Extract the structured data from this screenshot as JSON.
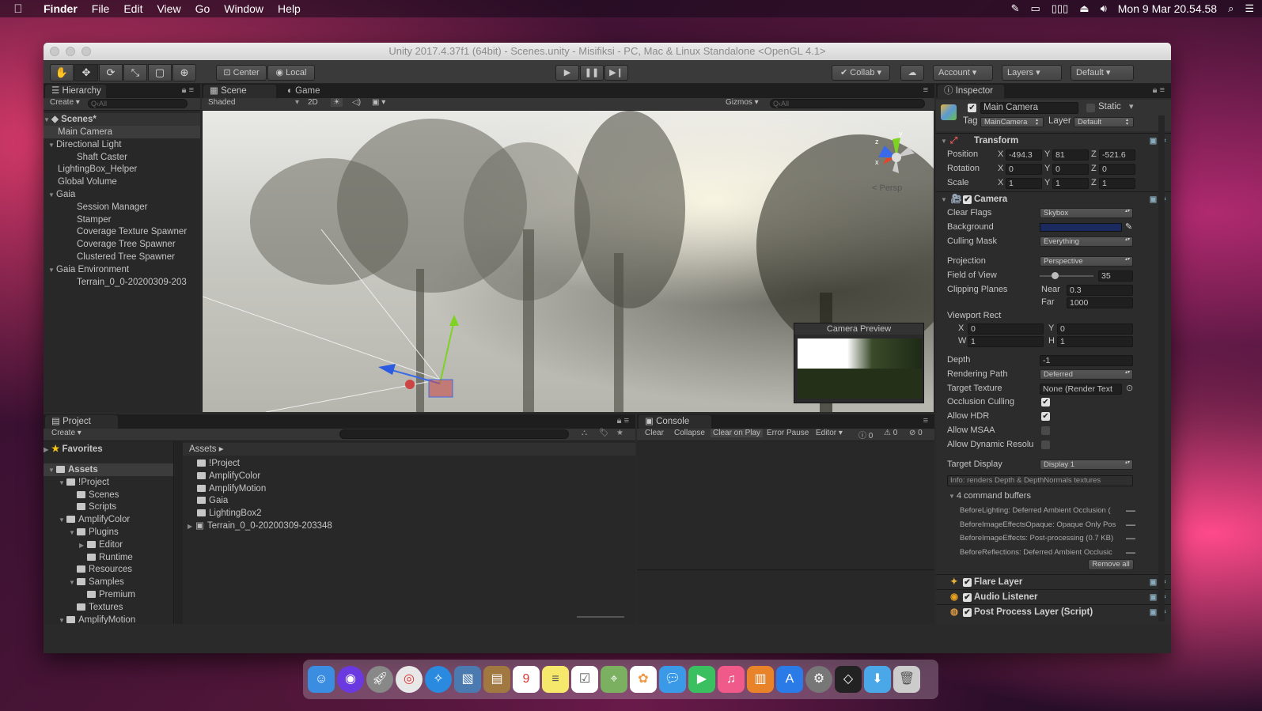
{
  "menubar": {
    "items": [
      "Finder",
      "File",
      "Edit",
      "View",
      "Go",
      "Window",
      "Help"
    ],
    "clock": "Mon 9 Mar  20.54.58"
  },
  "window": {
    "title": "Unity 2017.4.37f1 (64bit) - Scenes.unity - Misifiksi - PC, Mac & Linux Standalone <OpenGL 4.1>"
  },
  "toolbar": {
    "pivot": "Center",
    "space": "Local",
    "collab": "Collab",
    "account": "Account",
    "layers": "Layers",
    "layout": "Default"
  },
  "hierarchy": {
    "tab": "Hierarchy",
    "create": "Create",
    "search_placeholder": "Q‹All",
    "scene": "Scenes*",
    "items": [
      {
        "label": "Main Camera",
        "indent": 0,
        "selected": true
      },
      {
        "label": "Directional Light",
        "indent": 0,
        "expand": true
      },
      {
        "label": "Shaft Caster",
        "indent": 1
      },
      {
        "label": "LightingBox_Helper",
        "indent": 0
      },
      {
        "label": "Global Volume",
        "indent": 0
      },
      {
        "label": "Gaia",
        "indent": 0,
        "expand": true
      },
      {
        "label": "Session Manager",
        "indent": 1
      },
      {
        "label": "Stamper",
        "indent": 1
      },
      {
        "label": "Coverage Texture Spawner",
        "indent": 1
      },
      {
        "label": "Coverage Tree Spawner",
        "indent": 1
      },
      {
        "label": "Clustered Tree Spawner",
        "indent": 1
      },
      {
        "label": "Gaia Environment",
        "indent": 0,
        "expand": true
      },
      {
        "label": "Terrain_0_0-20200309-203",
        "indent": 1
      }
    ]
  },
  "sceneview": {
    "tab_scene": "Scene",
    "tab_game": "Game",
    "shading": "Shaded",
    "mode2d": "2D",
    "gizmos": "Gizmos",
    "search": "Q‹All",
    "persp": "< Persp",
    "camera_preview": "Camera Preview"
  },
  "project": {
    "tab": "Project",
    "create": "Create",
    "favorites": "Favorites",
    "breadcrumb": "Assets ▸",
    "tree": [
      {
        "label": "Assets",
        "indent": 0,
        "bold": true,
        "selected": true
      },
      {
        "label": "!Project",
        "indent": 1
      },
      {
        "label": "Scenes",
        "indent": 2
      },
      {
        "label": "Scripts",
        "indent": 2
      },
      {
        "label": "AmplifyColor",
        "indent": 1
      },
      {
        "label": "Plugins",
        "indent": 2
      },
      {
        "label": "Editor",
        "indent": 3
      },
      {
        "label": "Runtime",
        "indent": 3
      },
      {
        "label": "Resources",
        "indent": 2
      },
      {
        "label": "Samples",
        "indent": 2
      },
      {
        "label": "Premium",
        "indent": 3
      },
      {
        "label": "Textures",
        "indent": 2
      },
      {
        "label": "AmplifyMotion",
        "indent": 1
      }
    ],
    "assets": [
      "!Project",
      "AmplifyColor",
      "AmplifyMotion",
      "Gaia",
      "LightingBox2",
      "Terrain_0_0-20200309-203348"
    ]
  },
  "console": {
    "tab": "Console",
    "buttons": [
      "Clear",
      "Collapse",
      "Clear on Play",
      "Error Pause",
      "Editor"
    ],
    "counts": [
      "0",
      "0",
      "0"
    ]
  },
  "inspector": {
    "tab": "Inspector",
    "object_name": "Main Camera",
    "static": "Static",
    "tag_label": "Tag",
    "tag": "MainCamera",
    "layer_label": "Layer",
    "layer": "Default",
    "transform": {
      "title": "Transform",
      "position": {
        "label": "Position",
        "x": "-494.3",
        "y": "81",
        "z": "-521.6"
      },
      "rotation": {
        "label": "Rotation",
        "x": "0",
        "y": "0",
        "z": "0"
      },
      "scale": {
        "label": "Scale",
        "x": "1",
        "y": "1",
        "z": "1"
      }
    },
    "camera": {
      "title": "Camera",
      "clear_flags": {
        "label": "Clear Flags",
        "value": "Skybox"
      },
      "background": {
        "label": "Background",
        "color": "#1b2a5e"
      },
      "culling_mask": {
        "label": "Culling Mask",
        "value": "Everything"
      },
      "projection": {
        "label": "Projection",
        "value": "Perspective"
      },
      "fov": {
        "label": "Field of View",
        "value": "35",
        "fraction": 0.25
      },
      "clipping": {
        "label": "Clipping Planes",
        "near_label": "Near",
        "near": "0.3",
        "far_label": "Far",
        "far": "1000"
      },
      "viewport": {
        "label": "Viewport Rect",
        "x": "0",
        "y": "0",
        "w": "1",
        "h": "1"
      },
      "depth": {
        "label": "Depth",
        "value": "-1"
      },
      "rendering_path": {
        "label": "Rendering Path",
        "value": "Deferred"
      },
      "target_texture": {
        "label": "Target Texture",
        "value": "None (Render Text"
      },
      "occlusion": {
        "label": "Occlusion Culling",
        "checked": true
      },
      "hdr": {
        "label": "Allow HDR",
        "checked": true
      },
      "msaa": {
        "label": "Allow MSAA",
        "checked": false
      },
      "dynres": {
        "label": "Allow Dynamic Resolu",
        "checked": false
      },
      "target_display": {
        "label": "Target Display",
        "value": "Display 1"
      },
      "info": "Info: renders Depth & DepthNormals textures",
      "command_buffers_title": "4 command buffers",
      "command_buffers": [
        "BeforeLighting: Deferred Ambient Occlusion (",
        "BeforeImageEffectsOpaque: Opaque Only Pos",
        "BeforeImageEffects: Post-processing (0.7 KB)",
        "BeforeReflections: Deferred Ambient Occlusic"
      ],
      "remove_all": "Remove all"
    },
    "components": [
      "Flare Layer",
      "Audio Listener",
      "Post Process Layer (Script)"
    ]
  }
}
